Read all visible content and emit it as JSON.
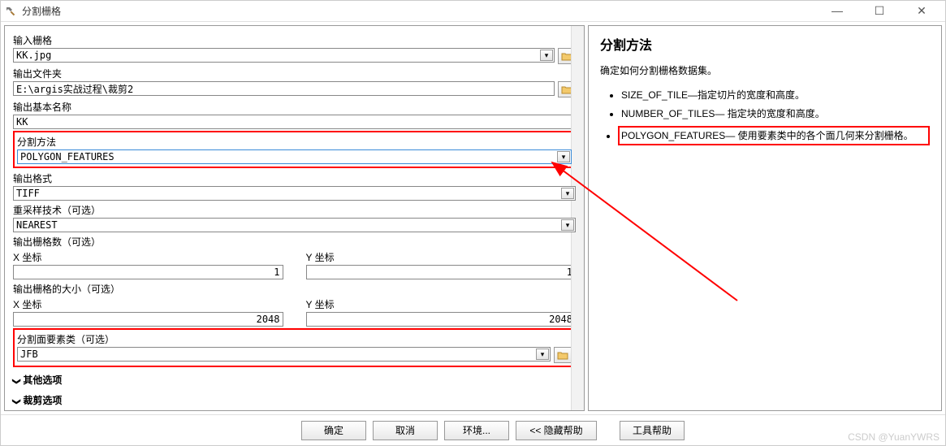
{
  "window": {
    "title": "分割栅格"
  },
  "form": {
    "input_raster": {
      "label": "输入栅格",
      "value": "KK.jpg"
    },
    "output_folder": {
      "label": "输出文件夹",
      "value": "E:\\argis实战过程\\裁剪2"
    },
    "output_basename": {
      "label": "输出基本名称",
      "value": "KK"
    },
    "split_method": {
      "label": "分割方法",
      "value": "POLYGON_FEATURES"
    },
    "output_format": {
      "label": "输出格式",
      "value": "TIFF"
    },
    "resample": {
      "label": "重采样技术（可选）",
      "value": "NEAREST"
    },
    "num_rasters": {
      "label": "输出栅格数（可选）",
      "x_label": "X 坐标",
      "x_value": "1",
      "y_label": "Y 坐标",
      "y_value": "1"
    },
    "raster_size": {
      "label": "输出栅格的大小（可选）",
      "x_label": "X 坐标",
      "x_value": "2048",
      "y_label": "Y 坐标",
      "y_value": "2048"
    },
    "split_polygon": {
      "label": "分割面要素类（可选）",
      "value": "JFB"
    },
    "other_options": "其他选项",
    "crop_options": "裁剪选项"
  },
  "buttons": {
    "ok": "确定",
    "cancel": "取消",
    "env": "环境...",
    "hide_help": "<< 隐藏帮助",
    "tool_help": "工具帮助"
  },
  "help": {
    "title": "分割方法",
    "desc": "确定如何分割栅格数据集。",
    "items": [
      "SIZE_OF_TILE—指定切片的宽度和高度。",
      "NUMBER_OF_TILES— 指定块的宽度和高度。",
      "POLYGON_FEATURES— 使用要素类中的各个面几何来分割栅格。"
    ]
  },
  "watermark": "CSDN @YuanYWRS"
}
